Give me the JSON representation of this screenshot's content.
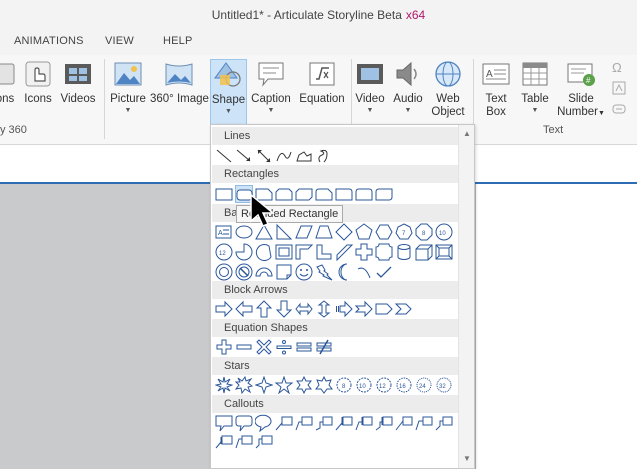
{
  "window": {
    "title": "Untitled1* -  Articulate Storyline Beta",
    "arch": "x64"
  },
  "tabs": [
    "ANIMATIONS",
    "VIEW",
    "HELP"
  ],
  "ribbon": {
    "buttons": [
      {
        "label": "ons",
        "icon": "icons-icon"
      },
      {
        "label": "Icons",
        "icon": "hand-icon"
      },
      {
        "label": "Videos",
        "icon": "film-icon"
      },
      {
        "label": "Picture",
        "icon": "picture-icon",
        "dropdown": true
      },
      {
        "label": "360° Image",
        "icon": "panorama-icon"
      },
      {
        "label": "Shape",
        "icon": "shape-icon",
        "dropdown": true,
        "active": true
      },
      {
        "label": "Caption",
        "icon": "caption-icon",
        "dropdown": true
      },
      {
        "label": "Equation",
        "icon": "equation-icon"
      },
      {
        "label": "Video",
        "icon": "video-icon",
        "dropdown": true
      },
      {
        "label": "Audio",
        "icon": "speaker-icon",
        "dropdown": true
      },
      {
        "label": "Web",
        "label2": "Object",
        "icon": "globe-icon"
      },
      {
        "label": "Text",
        "label2": "Box",
        "icon": "textbox-icon"
      },
      {
        "label": "Table",
        "icon": "table-icon",
        "dropdown": true
      },
      {
        "label": "Slide",
        "label2": "Number",
        "icon": "slide-number-icon",
        "dropdown": true
      }
    ],
    "groups": {
      "left": "y 360",
      "text": "Text"
    },
    "small_icons": [
      "omega-icon",
      "formula-icon",
      "link-icon"
    ]
  },
  "shape_menu": {
    "categories": [
      "Lines",
      "Rectangles",
      "Basic Shapes",
      "Block Arrows",
      "Equation Shapes",
      "Stars",
      "Callouts"
    ],
    "hovered": "Rounded Rectangle"
  },
  "tooltip": {
    "text": "Rounded Rectangle"
  },
  "colors": {
    "accent": "#2e6db4",
    "brand_x64": "#b0186b",
    "ribbon_active": "#cde3f7",
    "icon_blue": "#2b579a"
  }
}
